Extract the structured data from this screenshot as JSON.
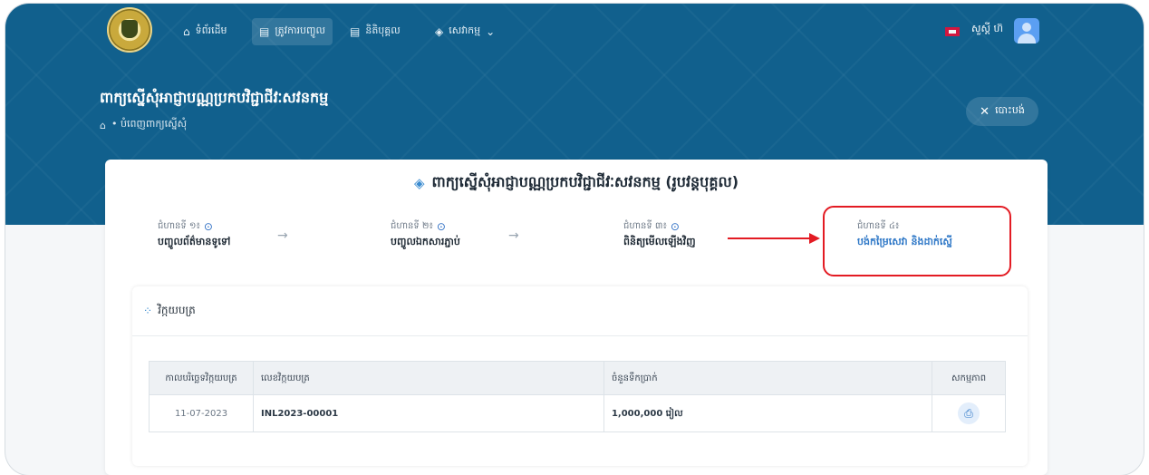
{
  "nav": {
    "items": [
      {
        "icon": "home-icon",
        "label": "ទំព័រដើម"
      },
      {
        "icon": "document-icon",
        "label": "ត្រូវការបញ្ចូល"
      },
      {
        "icon": "document-icon",
        "label": "និតិបុគ្គល"
      },
      {
        "icon": "layers-icon",
        "label": "សេវាកម្ម"
      }
    ],
    "user_name": "សួស្តី ហ៊"
  },
  "header": {
    "title": "ពាក្យស្នើសុំអាជ្ញាបណ្ណប្រកបវិជ្ជាជីវៈសវនកម្ម",
    "breadcrumb": "• បំពេញពាក្យស្នើសុំ",
    "close_label": "បោះបង់"
  },
  "card": {
    "title": "ពាក្យស្នើសុំអាជ្ញាបណ្ណប្រកបវិជ្ជាជីវៈសវនកម្ម (រូបវន្តបុគ្គល)",
    "steps": [
      {
        "label": "ជំហានទី ១៖",
        "text": "បញ្ចូលព័ត៌មានទូទៅ",
        "done": true
      },
      {
        "label": "ជំហានទី ២៖",
        "text": "បញ្ចូលឯកសារភ្ជាប់",
        "done": true
      },
      {
        "label": "ជំហានទី ៣៖",
        "text": "ពិនិត្យមើលឡើងវិញ",
        "done": true
      },
      {
        "label": "ជំហានទី ៤៖",
        "text": "បង់កម្រៃសេវា និងដាក់ស្នើ",
        "done": false
      }
    ]
  },
  "invoice": {
    "header": "វិក្កយបត្រ",
    "columns": [
      "កាលបរិច្ឆេទវិក្កយបត្រ",
      "លេខវិក្កយបត្រ",
      "ចំនួនទឹកប្រាក់",
      "សកម្មភាព"
    ],
    "rows": [
      {
        "date": "11-07-2023",
        "number": "INL2023-00001",
        "amount": "1,000,000 រៀល"
      }
    ]
  },
  "colors": {
    "header_bg": "#11608d",
    "accent": "#2f78c7",
    "annotation": "#e31b23"
  }
}
